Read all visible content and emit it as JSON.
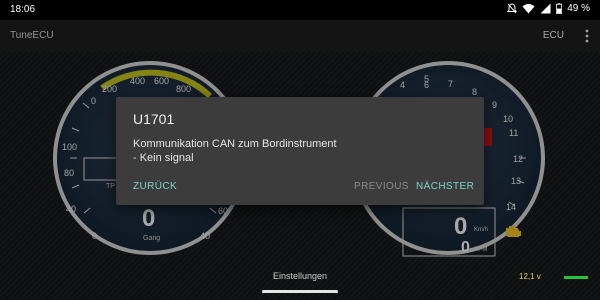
{
  "status": {
    "time": "18:06",
    "battery": "49 %"
  },
  "app": {
    "title": "TuneECU",
    "ecu_label": "ECU"
  },
  "gauge_left": {
    "rpm_ticks": [
      "0",
      "200",
      "400",
      "600",
      "800"
    ],
    "left_ticks": [
      "100",
      "80",
      "60",
      "40",
      "20",
      "0"
    ],
    "right_ticks": [
      "80",
      "60",
      "40"
    ],
    "tp_label": "TP",
    "gear_value": "0",
    "gear_label": "Gang"
  },
  "gauge_right": {
    "ticks": [
      "4",
      "5",
      "6",
      "7",
      "8",
      "9",
      "10",
      "11",
      "12",
      "13",
      "14"
    ],
    "speed_value": "0",
    "speed_unit": "Km/h",
    "rpm_value": "0",
    "rpm_unit": "RPM"
  },
  "dialog": {
    "code": "U1701",
    "message": "Kommunikation CAN zum Bordinstrument\n- Kein signal",
    "back": "ZURÜCK",
    "previous": "PREVIOUS",
    "next": "NÄCHSTER"
  },
  "footer": {
    "settings": "Einstellungen",
    "voltage": "12,1 v"
  },
  "colors": {
    "accent": "#7fd3c9",
    "voltage": "#e3d44a",
    "warning_light": "#e0b821",
    "redline": "#c0171a",
    "battery_ok": "#28c13a"
  }
}
